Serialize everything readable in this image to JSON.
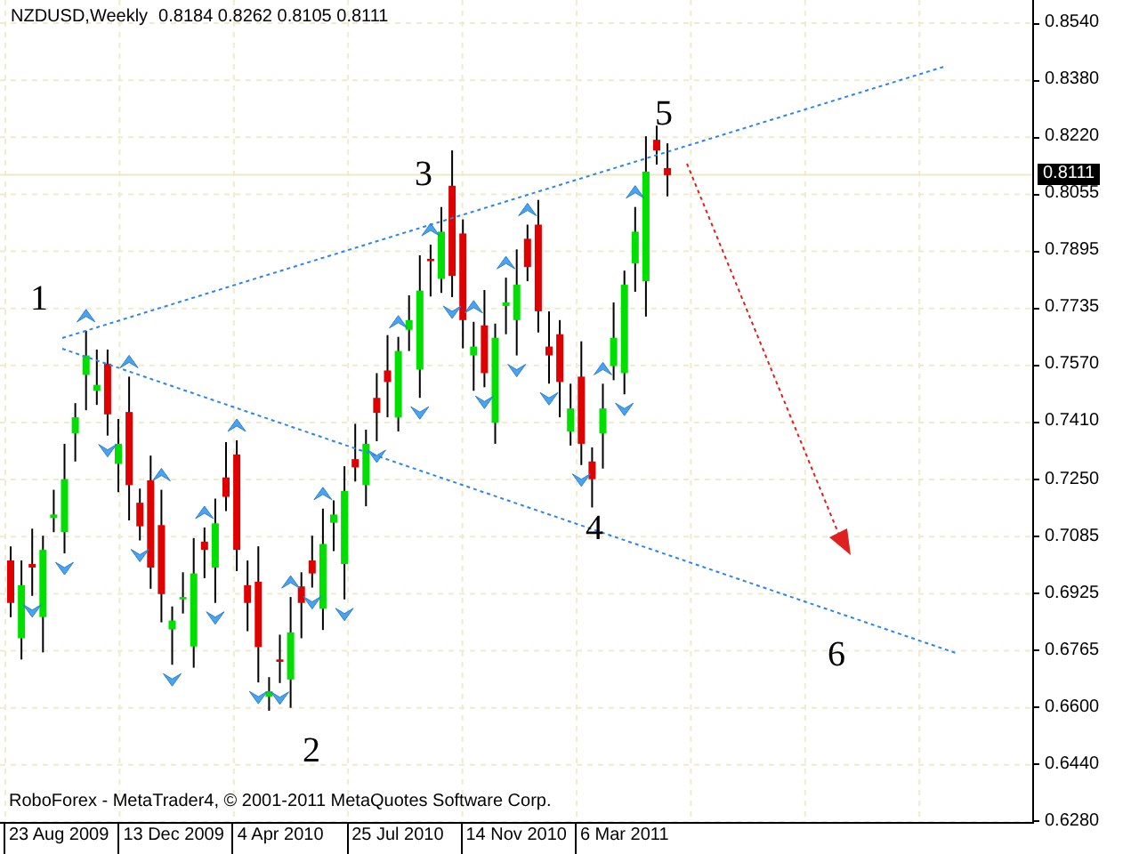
{
  "chart_header": {
    "symbol": "NZDUSD,Weekly",
    "ohlc": "0.8184 0.8262 0.8105 0.8111"
  },
  "wave_labels": [
    "1",
    "2",
    "3",
    "4",
    "5",
    "6"
  ],
  "copyright": "RoboForex - MetaTrader4, © 2001-2011 MetaQuotes Software Corp.",
  "price_axis": [
    "0.8540",
    "0.8380",
    "0.8220",
    "0.8055",
    "0.7895",
    "0.7735",
    "0.7570",
    "0.7410",
    "0.7250",
    "0.7085",
    "0.6925",
    "0.6765",
    "0.6600",
    "0.6440",
    "0.6280"
  ],
  "current_price": "0.8111",
  "time_axis": [
    "23 Aug 2009",
    "13 Dec 2009",
    "4 Apr 2010",
    "25 Jul 2010",
    "14 Nov 2010",
    "6 Mar 2011"
  ]
}
